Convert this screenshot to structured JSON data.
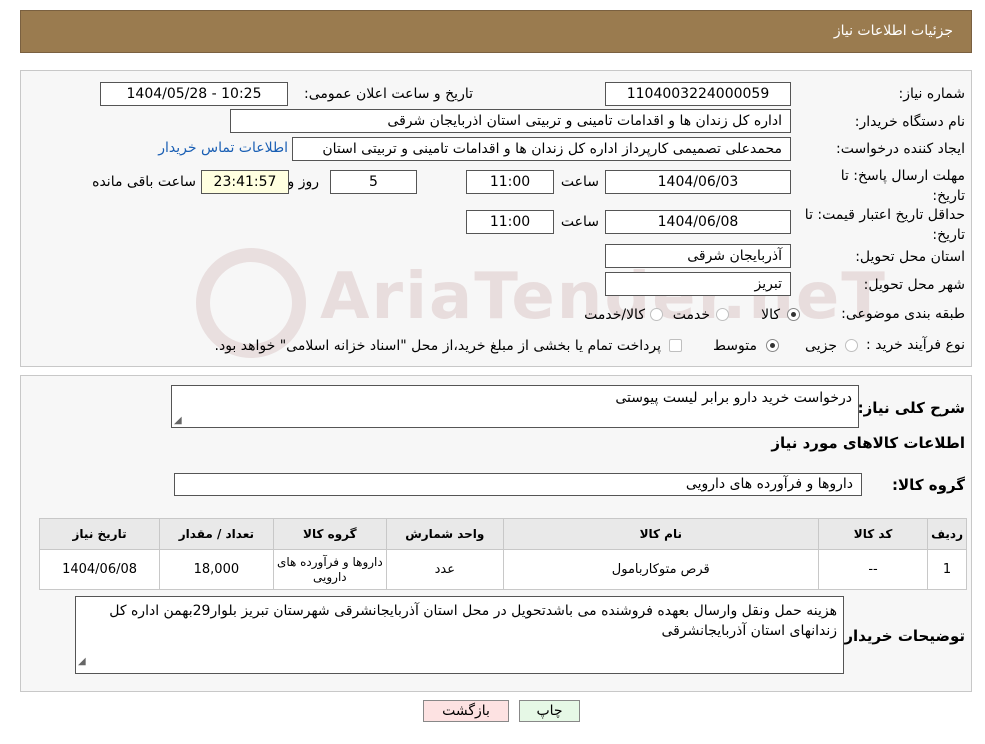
{
  "header": {
    "title": "جزئیات اطلاعات نیاز"
  },
  "form": {
    "need_number_label": "شماره نیاز:",
    "need_number": "1104003224000059",
    "announce_label": "تاریخ و ساعت اعلان عمومی:",
    "announce_value": "1404/05/28 - 10:25",
    "buyer_org_label": "نام دستگاه خریدار:",
    "buyer_org": "اداره کل زندان ها و اقدامات تامینی و تربیتی استان اذربایجان شرقی",
    "creator_label": "ایجاد کننده درخواست:",
    "creator": "محمدعلی تصمیمی کارپرداز اداره کل زندان ها و اقدامات تامینی و تربیتی استان",
    "contact_link": "اطلاعات تماس خریدار",
    "deadline_label": "مهلت ارسال پاسخ: تا تاریخ:",
    "deadline_date": "1404/06/03",
    "time_label": "ساعت",
    "deadline_time": "11:00",
    "days_value": "5",
    "days_label": "روز و",
    "remaining_time": "23:41:57",
    "remaining_label": "ساعت باقی مانده",
    "validity_label": "حداقل تاریخ اعتبار قیمت: تا تاریخ:",
    "validity_date": "1404/06/08",
    "validity_time": "11:00",
    "province_label": "استان محل تحویل:",
    "province": "آذربایجان شرقی",
    "city_label": "شهر محل تحویل:",
    "city": "تبریز",
    "category_label": "طبقه بندی موضوعی:",
    "category_options": [
      "کالا",
      "خدمت",
      "کالا/خدمت"
    ],
    "process_label": "نوع فرآیند خرید :",
    "process_options": [
      "جزیی",
      "متوسط"
    ],
    "process_note": "پرداخت تمام یا بخشی از مبلغ خرید،از محل \"اسناد خزانه اسلامی\" خواهد بود."
  },
  "details": {
    "summary_label": "شرح کلی نیاز:",
    "summary_text": "درخواست خرید دارو برابر لیست پیوستی",
    "goods_info_title": "اطلاعات کالاهای مورد نیاز",
    "goods_group_label": "گروه کالا:",
    "goods_group": "داروها و فرآورده های دارویی",
    "table": {
      "headers": [
        "ردیف",
        "کد کالا",
        "نام کالا",
        "واحد شمارش",
        "گروه کالا",
        "تعداد / مقدار",
        "تاریخ نیاز"
      ],
      "rows": [
        [
          "1",
          "--",
          "قرص متوکاربامول",
          "عدد",
          "داروها و فرآورده های دارویی",
          "18,000",
          "1404/06/08"
        ]
      ]
    },
    "buyer_notes_label": "توضیحات خریدار:",
    "buyer_notes": "هزینه حمل ونقل وارسال بعهده فروشنده می باشدتحویل در محل استان آذربایجانشرقی شهرستان تبریز بلوار29بهمن اداره کل زندانهای استان آذربایجانشرقی"
  },
  "buttons": {
    "print": "چاپ",
    "back": "بازگشت"
  },
  "watermark": "AriaTender.neT",
  "colors": {
    "header_bg": "#9a7b4f",
    "link": "#1a5fb4",
    "timer_bg": "#ffffe0",
    "back_btn_bg": "#fde2e2",
    "print_btn_bg": "#e6f8e6"
  }
}
